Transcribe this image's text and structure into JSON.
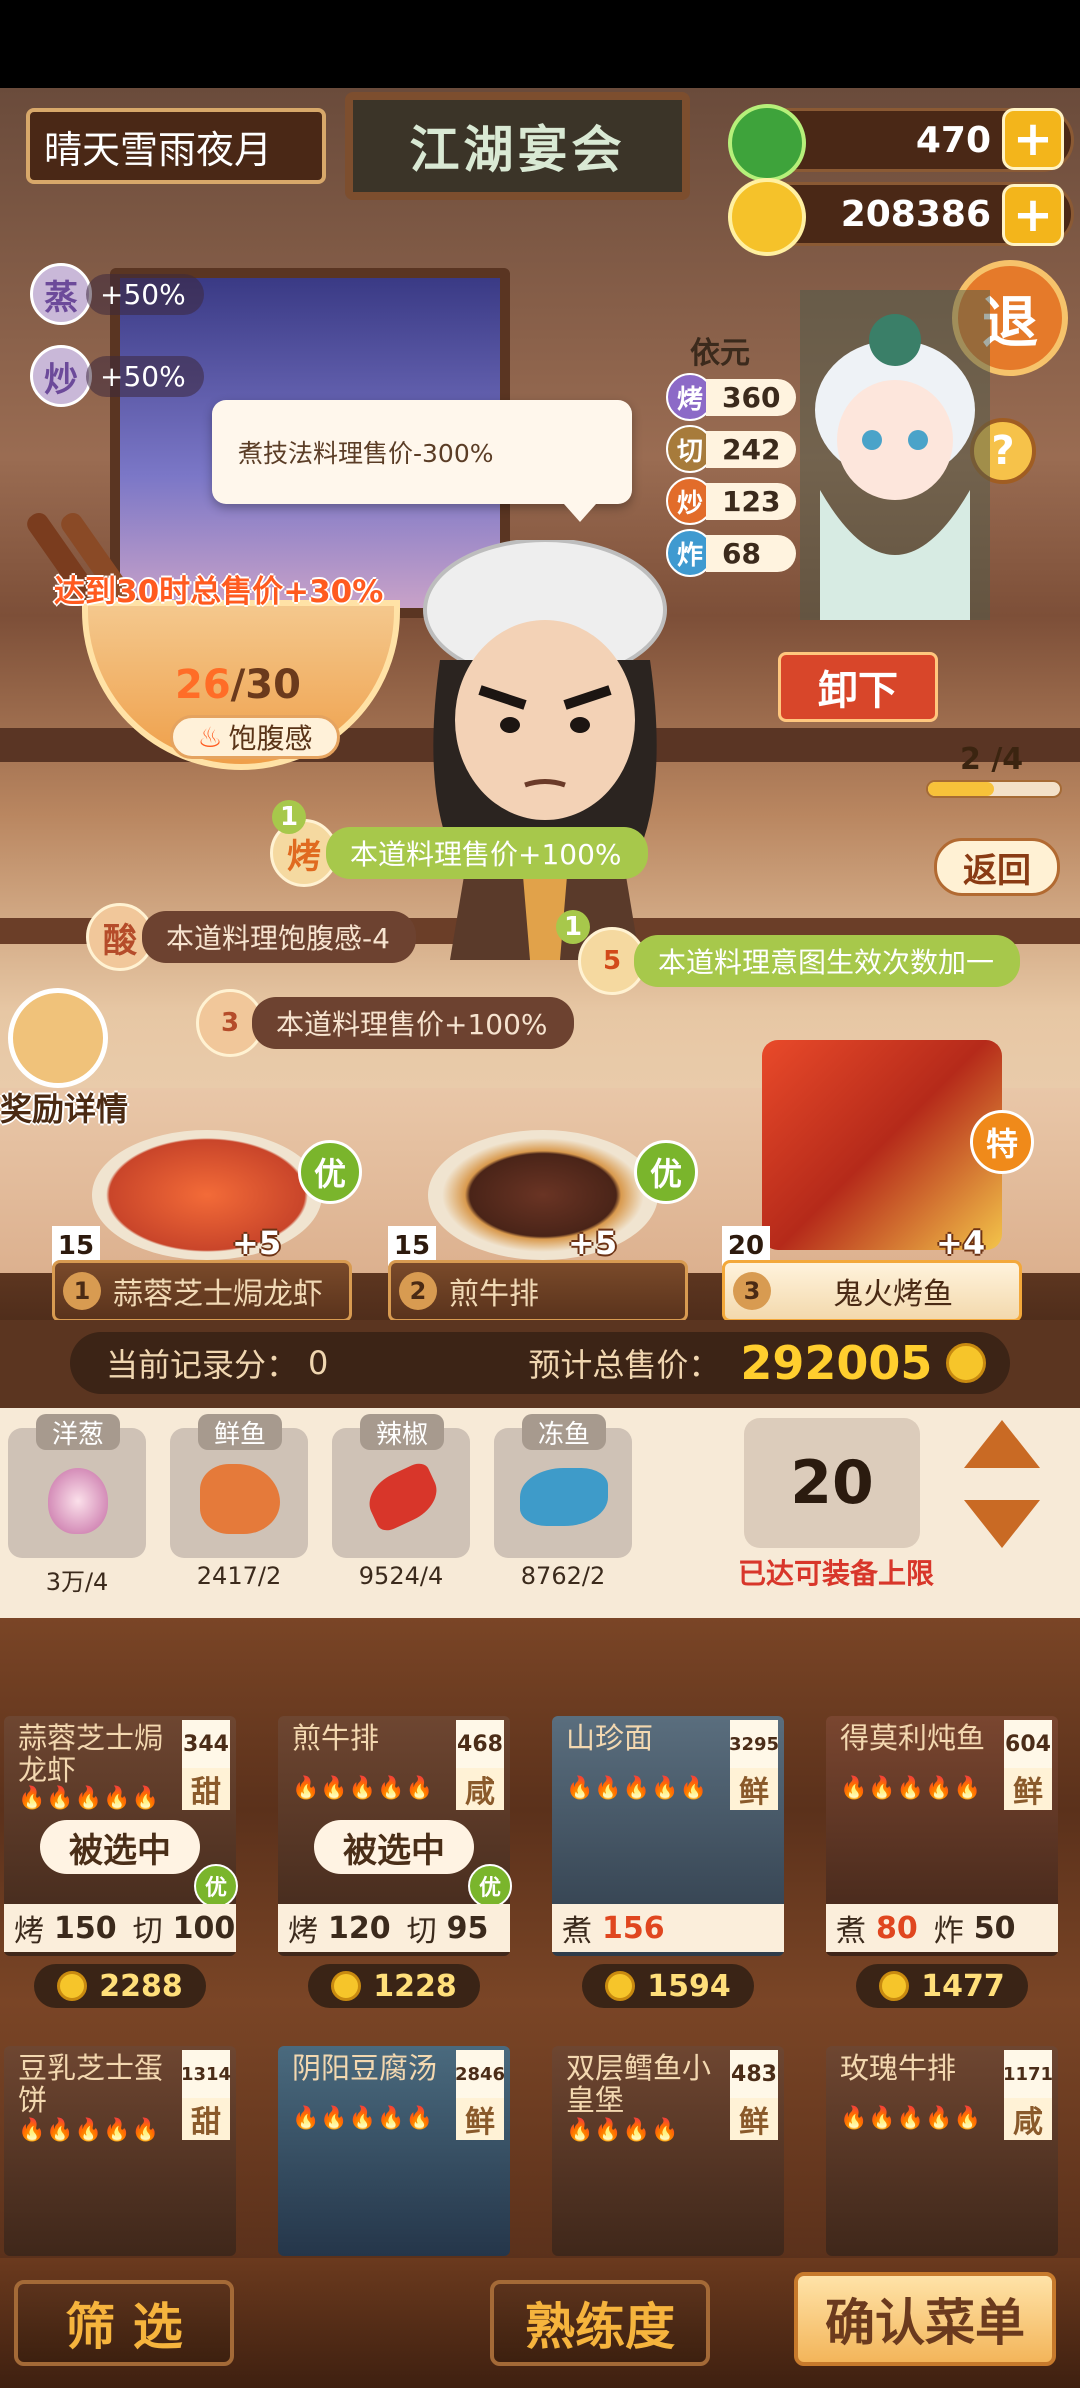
{
  "header": {
    "player_name": "晴天雪雨夜月",
    "title": "江湖宴会",
    "jade": "470",
    "coins": "208386",
    "exit_label": "退",
    "help_label": "?"
  },
  "bonuses": [
    {
      "char": "蒸",
      "text": "+50%"
    },
    {
      "char": "炒",
      "text": "+50%"
    }
  ],
  "tooltip": "煮技法料理售价-300%",
  "goal_text": "达到30时总售价+30%",
  "fullness": {
    "current": "26",
    "max": "/30",
    "label": "饱腹感"
  },
  "chef": {
    "name": "依元",
    "skills": [
      {
        "icon": "烤",
        "value": "360",
        "color": "#8c6ac7"
      },
      {
        "icon": "切",
        "value": "242",
        "color": "#a77b3b"
      },
      {
        "icon": "炒",
        "value": "123",
        "color": "#e26c2a"
      },
      {
        "icon": "炸",
        "value": "68",
        "color": "#3f9ad0"
      }
    ]
  },
  "unload_label": "卸下",
  "slots": "2 /4",
  "back_label": "返回",
  "effects": [
    {
      "num": "1",
      "icon": "烤",
      "text": "本道料理售价+100%"
    },
    {
      "icon": "酸",
      "text": "本道料理饱腹感-4"
    },
    {
      "num": "1",
      "icon": "5",
      "text": "本道料理意图生效次数加一"
    },
    {
      "icon": "3",
      "text": "本道料理售价+100%"
    }
  ],
  "reward_label": "奖励详情",
  "selected_dishes": [
    {
      "qty": "15",
      "bonus": "+5",
      "index": "1",
      "name": "蒜蓉芝士焗龙虾",
      "grade": "优"
    },
    {
      "qty": "15",
      "bonus": "+5",
      "index": "2",
      "name": "煎牛排",
      "grade": "优"
    },
    {
      "qty": "20",
      "bonus": "+4",
      "index": "3",
      "name": "鬼火烤鱼",
      "grade": "特"
    }
  ],
  "score": {
    "label": "当前记录分：",
    "value": "0",
    "total_label": "预计总售价：",
    "total": "292005"
  },
  "ingredients": [
    {
      "name": "洋葱",
      "count": "3万/4"
    },
    {
      "name": "鲜鱼",
      "count": "2417/2"
    },
    {
      "name": "辣椒",
      "count": "9524/4"
    },
    {
      "name": "冻鱼",
      "count": "8762/2"
    }
  ],
  "equip": {
    "count": "20",
    "limit_text": "已达可装备上限"
  },
  "recipes": [
    {
      "name": "蒜蓉芝士焗龙虾",
      "value": "344",
      "taste": "甜",
      "selected": "被选中",
      "grade": "优",
      "stat1": "烤",
      "v1": "150",
      "stat2": "切",
      "v2": "100",
      "price": "2288"
    },
    {
      "name": "煎牛排",
      "value": "468",
      "taste": "咸",
      "selected": "被选中",
      "grade": "优",
      "stat1": "烤",
      "v1": "120",
      "stat2": "切",
      "v2": "95",
      "price": "1228"
    },
    {
      "name": "山珍面",
      "value": "3295",
      "taste": "鲜",
      "stat1": "煮",
      "v1": "156",
      "price": "1594"
    },
    {
      "name": "得莫利炖鱼",
      "value": "604",
      "taste": "鲜",
      "stat1": "煮",
      "v1": "80",
      "stat2": "炸",
      "v2": "50",
      "price": "1477"
    },
    {
      "name": "豆乳芝士蛋饼",
      "value": "1314",
      "taste": "甜"
    },
    {
      "name": "阴阳豆腐汤",
      "value": "2846",
      "taste": "鲜"
    },
    {
      "name": "双层鳕鱼小皇堡",
      "value": "483",
      "taste": "鲜"
    },
    {
      "name": "玫瑰牛排",
      "value": "1171",
      "taste": "咸"
    }
  ],
  "bottom": {
    "filter": "筛 选",
    "proficiency": "熟练度",
    "confirm": "确认菜单"
  },
  "colors": {
    "accent_orange": "#ff6a1a",
    "gold": "#ffce2e",
    "green_tag": "#a7c84b",
    "red_text": "#d8362a"
  }
}
